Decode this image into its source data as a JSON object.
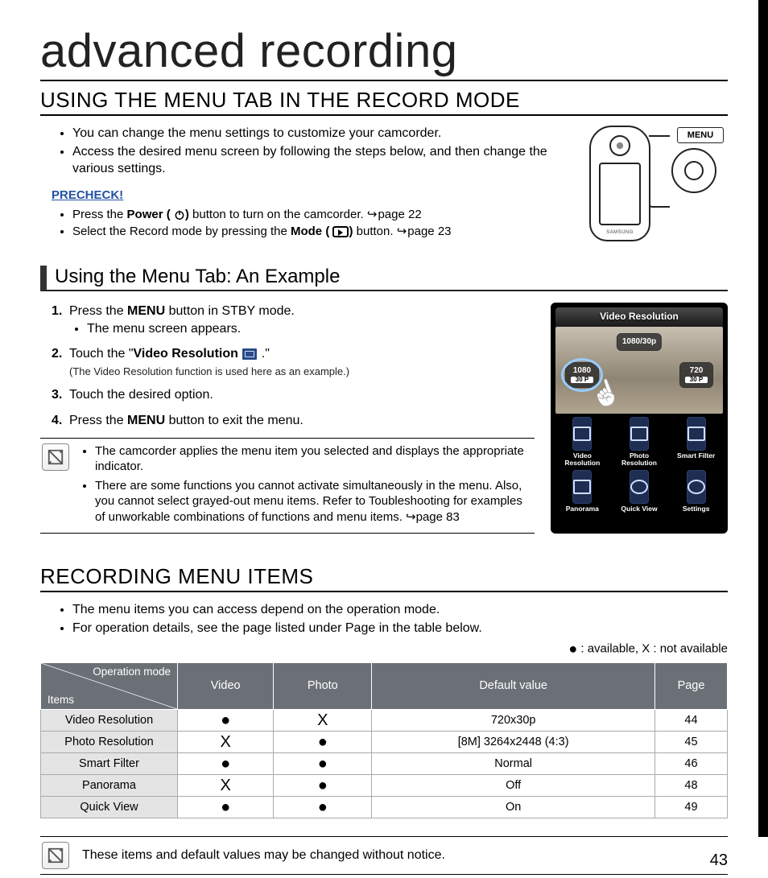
{
  "chapter": "advanced recording",
  "section1": {
    "title": "USING THE MENU TAB IN THE RECORD MODE",
    "bullets": [
      "You can change the menu settings to customize your camcorder.",
      "Access the desired menu screen by following the steps below, and then change the various settings."
    ],
    "precheck_label": "PRECHECK!",
    "precheck": {
      "a_prefix": "Press the ",
      "a_bold": "Power ( ",
      "a_bold2": ")",
      "a_suffix": " button to turn on the camcorder. ",
      "a_ref": "page 22",
      "b_prefix": "Select the Record mode by pressing the ",
      "b_bold": "Mode ( ",
      "b_bold2": ")",
      "b_suffix": " button. ",
      "b_ref": "page 23"
    },
    "menu_button_label": "MENU",
    "camcorder_brand": "SAMSUNG"
  },
  "subsection": {
    "title": "Using the Menu Tab: An Example",
    "steps": {
      "s1_a": "Press the ",
      "s1_b": "MENU",
      "s1_c": " button in STBY mode.",
      "s1_sub": "The menu screen appears.",
      "s2_a": "Touch the \"",
      "s2_b": "Video Resolution",
      "s2_c": " .\"",
      "s2_note": "(The Video Resolution function is used here as an example.)",
      "s3": "Touch the desired option.",
      "s4_a": "Press the ",
      "s4_b": "MENU",
      "s4_c": " button to exit the menu."
    },
    "note_bullets": [
      "The camcorder applies the menu item you selected and displays the appropriate indicator.",
      "There are some functions you cannot activate simultaneously in the menu. Also, you cannot select grayed-out menu items. Refer to Toubleshooting for examples of unworkable combinations of functions and menu items. ↪page 83"
    ],
    "screen": {
      "title": "Video Resolution",
      "opt_a": "1080/30p",
      "opt_b_top": "1080",
      "opt_b_sub": "30 P",
      "opt_c_top": "720",
      "opt_c_sub": "30 P",
      "labels": [
        "Video Resolution",
        "Photo Resolution",
        "Smart Filter",
        "Panorama",
        "Quick View",
        "Settings"
      ]
    }
  },
  "section2": {
    "title": "RECORDING MENU ITEMS",
    "bullets": [
      "The menu items you can access depend on the operation mode.",
      "For operation details, see the page listed under Page in the table below."
    ],
    "legend_avail": " : available, X : not available",
    "table": {
      "corner_op": "Operation mode",
      "corner_items": "Items",
      "headers": [
        "Video",
        "Photo",
        "Default value",
        "Page"
      ],
      "rows": [
        {
          "item": "Video Resolution",
          "video": "●",
          "photo": "X",
          "def": "720x30p",
          "page": "44"
        },
        {
          "item": "Photo Resolution",
          "video": "X",
          "photo": "●",
          "def": "[8M] 3264x2448 (4:3)",
          "page": "45"
        },
        {
          "item": "Smart Filter",
          "video": "●",
          "photo": "●",
          "def": "Normal",
          "page": "46"
        },
        {
          "item": "Panorama",
          "video": "X",
          "photo": "●",
          "def": "Off",
          "page": "48"
        },
        {
          "item": "Quick View",
          "video": "●",
          "photo": "●",
          "def": "On",
          "page": "49"
        }
      ]
    }
  },
  "footer_note": "These items and default values may be changed without notice.",
  "page_number": "43"
}
